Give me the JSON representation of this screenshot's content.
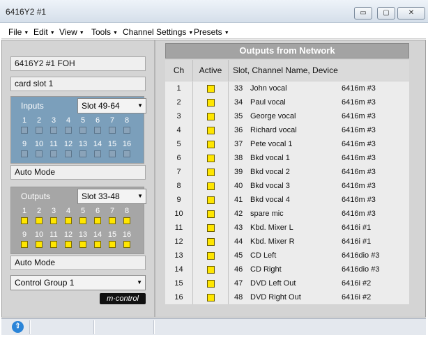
{
  "window": {
    "title": "6416Y2 #1",
    "minimize": "▭",
    "maximize": "▢",
    "close": "✕"
  },
  "menu": [
    {
      "label": "File"
    },
    {
      "label": "Edit"
    },
    {
      "label": "View"
    },
    {
      "label": "Tools"
    },
    {
      "label": "Channel Settings"
    },
    {
      "label": "Presets"
    }
  ],
  "left": {
    "device_name": "6416Y2 #1 FOH",
    "card_slot": "card slot 1",
    "inputs": {
      "label": "Inputs",
      "slot_select": "Slot 49-64",
      "channels": [
        "1",
        "2",
        "3",
        "4",
        "5",
        "6",
        "7",
        "8",
        "9",
        "10",
        "11",
        "12",
        "13",
        "14",
        "15",
        "16"
      ],
      "active": [
        false,
        false,
        false,
        false,
        false,
        false,
        false,
        false,
        false,
        false,
        false,
        false,
        false,
        false,
        false,
        false
      ]
    },
    "inputs_mode": "Auto Mode",
    "outputs": {
      "label": "Outputs",
      "slot_select": "Slot 33-48",
      "channels": [
        "1",
        "2",
        "3",
        "4",
        "5",
        "6",
        "7",
        "8",
        "9",
        "10",
        "11",
        "12",
        "13",
        "14",
        "15",
        "16"
      ],
      "active": [
        true,
        true,
        true,
        true,
        true,
        true,
        true,
        true,
        true,
        true,
        true,
        true,
        true,
        true,
        true,
        true
      ]
    },
    "outputs_mode": "Auto Mode",
    "control_group": "Control Group 1",
    "logo": "m·control"
  },
  "right": {
    "title": "Outputs from Network",
    "columns": {
      "ch": "Ch",
      "active": "Active",
      "slot": "Slot, Channel Name, Device"
    },
    "rows": [
      {
        "ch": "1",
        "slot": "33",
        "name": "John vocal",
        "device": "6416m #3"
      },
      {
        "ch": "2",
        "slot": "34",
        "name": "Paul vocal",
        "device": "6416m #3"
      },
      {
        "ch": "3",
        "slot": "35",
        "name": "George vocal",
        "device": "6416m #3"
      },
      {
        "ch": "4",
        "slot": "36",
        "name": "Richard vocal",
        "device": "6416m #3"
      },
      {
        "ch": "5",
        "slot": "37",
        "name": "Pete vocal 1",
        "device": "6416m #3"
      },
      {
        "ch": "6",
        "slot": "38",
        "name": "Bkd vocal 1",
        "device": "6416m #3"
      },
      {
        "ch": "7",
        "slot": "39",
        "name": "Bkd vocal 2",
        "device": "6416m #3"
      },
      {
        "ch": "8",
        "slot": "40",
        "name": "Bkd vocal 3",
        "device": "6416m #3"
      },
      {
        "ch": "9",
        "slot": "41",
        "name": "Bkd vocal 4",
        "device": "6416m #3"
      },
      {
        "ch": "10",
        "slot": "42",
        "name": "spare mic",
        "device": "6416m #3"
      },
      {
        "ch": "11",
        "slot": "43",
        "name": "Kbd. Mixer L",
        "device": "6416i #1"
      },
      {
        "ch": "12",
        "slot": "44",
        "name": "Kbd. Mixer R",
        "device": "6416i #1"
      },
      {
        "ch": "13",
        "slot": "45",
        "name": "CD Left",
        "device": "6416dio #3"
      },
      {
        "ch": "14",
        "slot": "46",
        "name": "CD Right",
        "device": "6416dio #3"
      },
      {
        "ch": "15",
        "slot": "47",
        "name": "DVD Left Out",
        "device": "6416i #2"
      },
      {
        "ch": "16",
        "slot": "48",
        "name": "DVD Right Out",
        "device": "6416i #2"
      }
    ]
  },
  "colors": {
    "active": "#ffe600",
    "inputs_panel": "#7b9fbb",
    "outputs_panel": "#a6a6a6"
  }
}
